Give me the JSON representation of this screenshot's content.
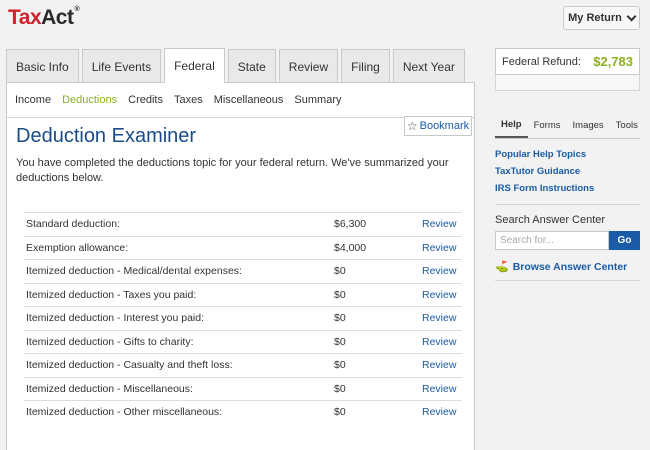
{
  "header": {
    "logo": {
      "tax": "Tax",
      "act": "Act",
      "reg": "®"
    },
    "my_return_label": "My Return"
  },
  "tabs": [
    {
      "label": "Basic Info",
      "active": false
    },
    {
      "label": "Life Events",
      "active": false
    },
    {
      "label": "Federal",
      "active": true
    },
    {
      "label": "State",
      "active": false
    },
    {
      "label": "Review",
      "active": false
    },
    {
      "label": "Filing",
      "active": false
    },
    {
      "label": "Next Year",
      "active": false
    }
  ],
  "subnav": [
    {
      "label": "Income",
      "active": false
    },
    {
      "label": "Deductions",
      "active": true
    },
    {
      "label": "Credits",
      "active": false
    },
    {
      "label": "Taxes",
      "active": false
    },
    {
      "label": "Miscellaneous",
      "active": false
    },
    {
      "label": "Summary",
      "active": false
    }
  ],
  "main": {
    "title": "Deduction Examiner",
    "bookmark_label": "Bookmark",
    "intro": "You have completed the deductions topic for your federal return. We've summarized your deductions below.",
    "rows": [
      {
        "label": "Standard deduction:",
        "amount": "$6,300",
        "action": "Review"
      },
      {
        "label": "Exemption allowance:",
        "amount": "$4,000",
        "action": "Review"
      },
      {
        "label": "Itemized deduction - Medical/dental expenses:",
        "amount": "$0",
        "action": "Review"
      },
      {
        "label": "Itemized deduction - Taxes you paid:",
        "amount": "$0",
        "action": "Review"
      },
      {
        "label": "Itemized deduction - Interest you paid:",
        "amount": "$0",
        "action": "Review"
      },
      {
        "label": "Itemized deduction - Gifts to charity:",
        "amount": "$0",
        "action": "Review"
      },
      {
        "label": "Itemized deduction - Casualty and theft loss:",
        "amount": "$0",
        "action": "Review"
      },
      {
        "label": "Itemized deduction - Miscellaneous:",
        "amount": "$0",
        "action": "Review"
      },
      {
        "label": "Itemized deduction - Other miscellaneous:",
        "amount": "$0",
        "action": "Review"
      }
    ]
  },
  "sidebar": {
    "refund_label": "Federal Refund:",
    "refund_value": "$2,783",
    "tabs": [
      {
        "label": "Help",
        "active": true
      },
      {
        "label": "Forms",
        "active": false
      },
      {
        "label": "Images",
        "active": false
      },
      {
        "label": "Tools",
        "active": false
      }
    ],
    "links": [
      "Popular Help Topics",
      "TaxTutor Guidance",
      "IRS Form Instructions"
    ],
    "search_title": "Search Answer Center",
    "search_placeholder": "Search for...",
    "go_label": "Go",
    "browse_label": "Browse Answer Center"
  },
  "colors": {
    "accent_green": "#8ab020",
    "link_blue": "#1a5ba6",
    "title_blue": "#1a4c8a",
    "logo_red": "#d0222b"
  }
}
